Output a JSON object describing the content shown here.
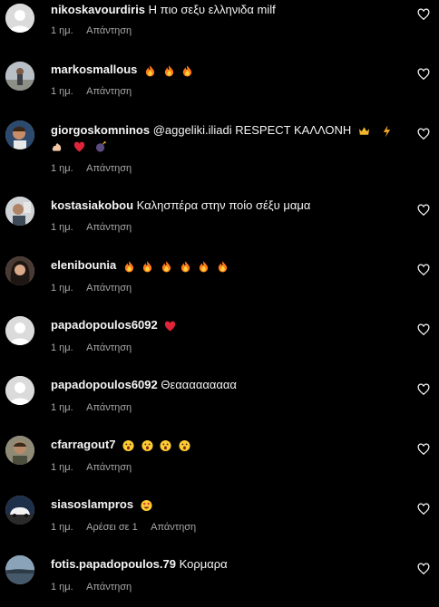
{
  "colors": {
    "background": "#000000",
    "text": "#f5f5f5",
    "meta_text": "#a8a8a8",
    "heart_red": "#ff3040"
  },
  "comments": [
    {
      "username": "nikoskavourdiris",
      "text": "Η πιο σεξυ ελληνιδα milf",
      "time": "1 ημ.",
      "likes": "",
      "reply": "Απάντηση",
      "avatar": "default-avatar-icon"
    },
    {
      "username": "markosmallous",
      "text": "",
      "emojis": [
        "fire-emoji",
        "fire-emoji",
        "fire-emoji"
      ],
      "time": "1 ημ.",
      "likes": "",
      "reply": "Απάντηση",
      "avatar": "user-photo"
    },
    {
      "username": "giorgoskomninos",
      "text": "@aggeliki.iliadi RESPECT ΚΑΛΛΟΝΗ",
      "emojis": [
        "crown-emoji",
        "lightning-emoji"
      ],
      "emojis_line2": [
        "flexed-biceps-emoji",
        "red-heart-emoji",
        "bomb-emoji"
      ],
      "time": "1 ημ.",
      "likes": "",
      "reply": "Απάντηση",
      "avatar": "user-photo"
    },
    {
      "username": "kostasiakobou",
      "text": "Καλησπέρα στην ποίο σέξυ μαμα",
      "time": "1 ημ.",
      "likes": "",
      "reply": "Απάντηση",
      "avatar": "user-photo"
    },
    {
      "username": "elenibounia",
      "text": "",
      "emojis": [
        "fire-emoji",
        "fire-emoji",
        "fire-emoji",
        "fire-emoji",
        "fire-emoji",
        "fire-emoji"
      ],
      "time": "1 ημ.",
      "likes": "",
      "reply": "Απάντηση",
      "avatar": "user-photo"
    },
    {
      "username": "papadopoulos6092",
      "text": "",
      "emojis": [
        "red-heart-emoji"
      ],
      "time": "1 ημ.",
      "likes": "",
      "reply": "Απάντηση",
      "avatar": "default-avatar-icon"
    },
    {
      "username": "papadopoulos6092",
      "text": "Θεααααααααα",
      "time": "1 ημ.",
      "likes": "",
      "reply": "Απάντηση",
      "avatar": "default-avatar-icon"
    },
    {
      "username": "cfarragout7",
      "text": "",
      "emojis": [
        "astonished-face-emoji",
        "astonished-face-emoji",
        "astonished-face-emoji",
        "astonished-face-emoji"
      ],
      "time": "1 ημ.",
      "likes": "",
      "reply": "Απάντηση",
      "avatar": "user-photo"
    },
    {
      "username": "siasoslampros",
      "text": "",
      "emojis": [
        "heart-eyes-emoji"
      ],
      "time": "1 ημ.",
      "likes": "Αρέσει σε 1",
      "reply": "Απάντηση",
      "avatar": "user-photo"
    },
    {
      "username": "fotis.papadopoulos.79",
      "text": "Κορμαρα",
      "time": "1 ημ.",
      "likes": "",
      "reply": "Απάντηση",
      "avatar": "user-photo"
    }
  ]
}
